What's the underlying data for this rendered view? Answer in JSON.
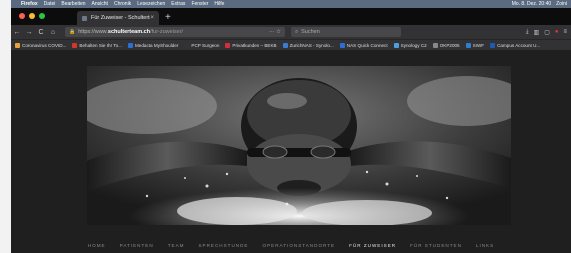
{
  "menubar": {
    "items": [
      "Firefox",
      "Datei",
      "Bearbeiten",
      "Ansicht",
      "Chronik",
      "Lesezeichen",
      "Extras",
      "Fenster",
      "Hilfe"
    ],
    "clock": "Mo. 8. Dez. 20:40",
    "user": "Zoini"
  },
  "tab": {
    "title": "Für Zuweiser - Schulterteam",
    "close": "×",
    "newtab": "+"
  },
  "nav": {
    "back": "←",
    "forward": "→",
    "reload": "C",
    "home": "⌂",
    "url_prefix": "https://www.",
    "url_host": "schulterteam.ch",
    "url_path": "/fur-zuweiser/",
    "url_tools": "··· ☆",
    "search_placeholder": "Suchen"
  },
  "bookmarks": [
    {
      "label": "Coronavirus COVID...",
      "color": "#e8a23a"
    },
    {
      "label": "Behalten Sie Ihr To...",
      "color": "#d8332c"
    },
    {
      "label": "Medacta MyShoulder",
      "color": "#2a6fd6"
    },
    {
      "label": "PCP Surgeon",
      "color": "#333333"
    },
    {
      "label": "Privatkunden – BEKB",
      "color": "#d0303a"
    },
    {
      "label": "ZurichNAS - Synolo...",
      "color": "#3a7bd5"
    },
    {
      "label": "NAS Quick Connect",
      "color": "#2a6fd6"
    },
    {
      "label": "Synology C2",
      "color": "#4a9fe0"
    },
    {
      "label": "OKP2005",
      "color": "#888888"
    },
    {
      "label": "SIWF",
      "color": "#2f7fd0"
    },
    {
      "label": "Campus Account U...",
      "color": "#1e5ab4"
    }
  ],
  "site_nav": {
    "items": [
      "HOME",
      "PATIENTEN",
      "TEAM",
      "SPRECHSTUNDE",
      "OPERATIONSTANDORTE",
      "FÜR ZUWEISER",
      "FÜR STUDENTEN",
      "LINKS"
    ],
    "active": "FÜR ZUWEISER"
  },
  "colors": {
    "traffic_close": "#ff5f57",
    "traffic_min": "#febc2e",
    "traffic_max": "#28c840"
  }
}
